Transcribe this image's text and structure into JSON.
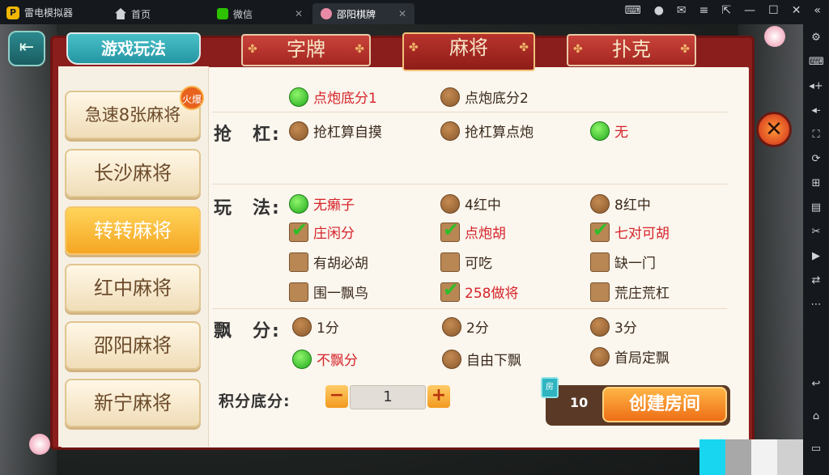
{
  "emulator": {
    "app_name": "雷电模拟器",
    "tabs": [
      {
        "label": "首页",
        "icon": "home-icon"
      },
      {
        "label": "微信",
        "icon": "wechat-icon"
      },
      {
        "label": "邵阳棋牌",
        "icon": "game-icon",
        "active": true
      }
    ]
  },
  "header": {
    "title": "游戏玩法",
    "categories": [
      "字牌",
      "麻将",
      "扑克"
    ],
    "active_category": "麻将"
  },
  "games": [
    {
      "label": "急速8张麻将",
      "badge": "火爆"
    },
    {
      "label": "长沙麻将"
    },
    {
      "label": "转转麻将",
      "active": true
    },
    {
      "label": "红中麻将"
    },
    {
      "label": "邵阳麻将"
    },
    {
      "label": "新宁麻将"
    }
  ],
  "options": {
    "dianpao": {
      "items": [
        {
          "label": "点炮底分1",
          "selected": true
        },
        {
          "label": "点炮底分2",
          "selected": false
        }
      ]
    },
    "qianggang": {
      "label": "抢　杠:",
      "items": [
        {
          "label": "抢杠算自摸",
          "selected": false
        },
        {
          "label": "抢杠算点炮",
          "selected": false
        },
        {
          "label": "无",
          "selected": true
        }
      ]
    },
    "wanfa": {
      "label": "玩　法:",
      "radios": [
        {
          "label": "无癞子",
          "selected": true
        },
        {
          "label": "4红中",
          "selected": false
        },
        {
          "label": "8红中",
          "selected": false
        }
      ],
      "checks": [
        {
          "label": "庄闲分",
          "checked": true
        },
        {
          "label": "点炮胡",
          "checked": true
        },
        {
          "label": "七对可胡",
          "checked": true
        },
        {
          "label": "有胡必胡",
          "checked": false
        },
        {
          "label": "可吃",
          "checked": false
        },
        {
          "label": "缺一门",
          "checked": false
        },
        {
          "label": "围一飘鸟",
          "checked": false
        },
        {
          "label": "258做将",
          "checked": true
        },
        {
          "label": "荒庄荒杠",
          "checked": false
        }
      ]
    },
    "piaofen": {
      "label": "飘　分:",
      "items": [
        {
          "label": "1分",
          "selected": false
        },
        {
          "label": "2分",
          "selected": false
        },
        {
          "label": "3分",
          "selected": false
        },
        {
          "label": "不飘分",
          "selected": true
        },
        {
          "label": "自由下飘",
          "selected": false
        },
        {
          "label": "首局定飘",
          "selected": false
        }
      ]
    }
  },
  "footer": {
    "score_label": "积分底分:",
    "minus": "−",
    "plus": "+",
    "score_value": "1",
    "card_count": "10",
    "card_icon_text": "房",
    "create_label": "创建房间"
  },
  "colors": {
    "panel_red": "#8a1e1c",
    "accent_orange": "#ee6e16",
    "selected_text": "#d6242a",
    "teal": "#2596a4"
  }
}
